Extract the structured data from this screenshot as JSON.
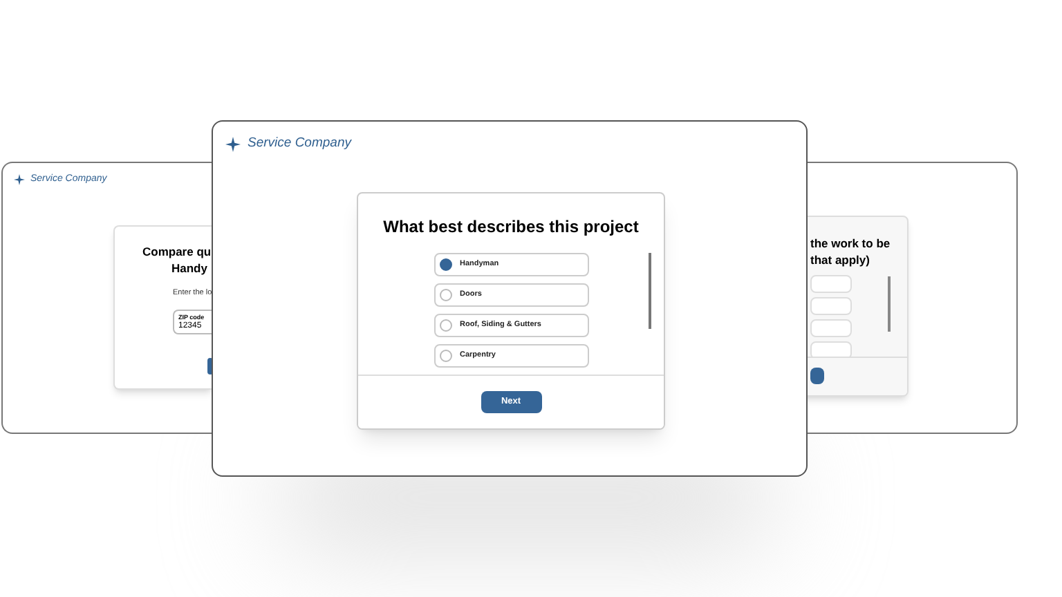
{
  "left_window": {
    "brand": "Service Company",
    "card": {
      "title_lines": [
        "Compare qu",
        "Handy"
      ],
      "prompt": "Enter the lo",
      "zip": {
        "label": "ZIP code",
        "value": "12345"
      }
    }
  },
  "main_window": {
    "brand": "Service Company",
    "card": {
      "title": "What best describes this project",
      "options": [
        {
          "label": "Handyman",
          "selected": true
        },
        {
          "label": "Doors",
          "selected": false
        },
        {
          "label": "Roof, Siding & Gutters",
          "selected": false
        },
        {
          "label": "Carpentry",
          "selected": false
        }
      ],
      "next_button": "Next"
    }
  },
  "right_window": {
    "card": {
      "title_lines": [
        "the work to be",
        "that apply)"
      ]
    }
  }
}
